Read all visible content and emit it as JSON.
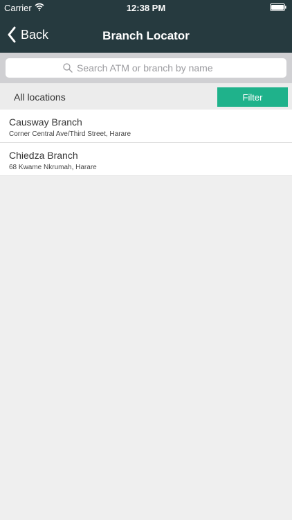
{
  "status_bar": {
    "carrier": "Carrier",
    "time": "12:38 PM",
    "icons": [
      "wifi-icon",
      "battery-icon"
    ]
  },
  "nav": {
    "back_label": "Back",
    "title": "Branch Locator",
    "background_color": "#263a3f"
  },
  "search": {
    "placeholder": "Search ATM or branch by name",
    "value": ""
  },
  "filter_row": {
    "locations_label": "All locations",
    "filter_label": "Filter",
    "accent_color": "#1fb28b"
  },
  "branches": [
    {
      "name": "Causway Branch",
      "address": "Corner Central Ave/Third Street, Harare"
    },
    {
      "name": "Chiedza Branch",
      "address": "68 Kwame Nkrumah, Harare"
    }
  ]
}
